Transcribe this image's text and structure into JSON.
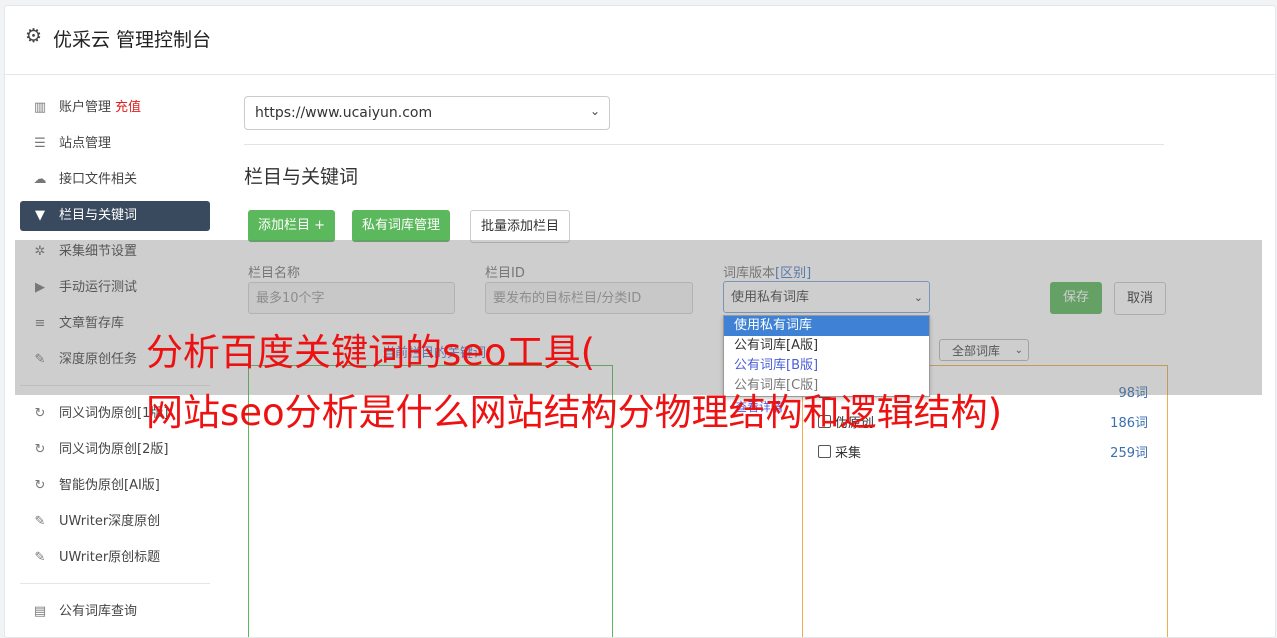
{
  "app": {
    "title": "优采云 管理控制台"
  },
  "sidebar": {
    "items": [
      {
        "label": "账户管理",
        "badge": "充值",
        "icon": "bar-chart-icon"
      },
      {
        "label": "站点管理",
        "icon": "server-icon"
      },
      {
        "label": "接口文件相关",
        "icon": "cloud-upload-icon"
      },
      {
        "label": "栏目与关键词",
        "icon": "filter-icon",
        "active": true
      },
      {
        "label": "采集细节设置",
        "icon": "gears-icon"
      },
      {
        "label": "手动运行测试",
        "icon": "play-circle-icon"
      },
      {
        "label": "文章暂存库",
        "icon": "database-icon"
      },
      {
        "label": "深度原创任务",
        "icon": "edit-icon"
      }
    ],
    "items2": [
      {
        "label": "同义词伪原创[1版]",
        "icon": "refresh-icon"
      },
      {
        "label": "同义词伪原创[2版]",
        "icon": "refresh-icon"
      },
      {
        "label": "智能伪原创[AI版]",
        "icon": "refresh-icon"
      },
      {
        "label": "UWriter深度原创",
        "icon": "edit-icon"
      },
      {
        "label": "UWriter原创标题",
        "icon": "edit-icon"
      }
    ],
    "items3": [
      {
        "label": "公有词库查询",
        "icon": "book-icon"
      }
    ]
  },
  "main": {
    "site_select": "https://www.ucaiyun.com",
    "section_title": "栏目与关键词",
    "buttons": {
      "add": "添加栏目 +",
      "private": "私有词库管理",
      "batch": "批量添加栏目"
    },
    "form": {
      "name_label": "栏目名称",
      "name_placeholder": "最多10个字",
      "id_label": "栏目ID",
      "id_placeholder": "要发布的目标栏目/分类ID",
      "version_label": "词库版本",
      "version_link": "[区别]",
      "version_value": "使用私有词库",
      "save": "保存",
      "cancel": "取消"
    },
    "dropdown": [
      "使用私有词库",
      "公有词库[A版]",
      "公有词库[B版]",
      "公有词库[C版]"
    ],
    "dropdown_last_partial": "查看详情",
    "pane_label": "当前栏目的关键词",
    "lib_filter": "全部词库",
    "libraries": [
      {
        "name": "",
        "count": "98词"
      },
      {
        "name": "伪原创",
        "count": "186词"
      },
      {
        "name": "采集",
        "count": "259词"
      }
    ]
  },
  "watermark": {
    "line1": "分析百度关键词的seo工具(",
    "line2": "网站seo分析是什么网站结构分物理结构和逻辑结构)"
  }
}
